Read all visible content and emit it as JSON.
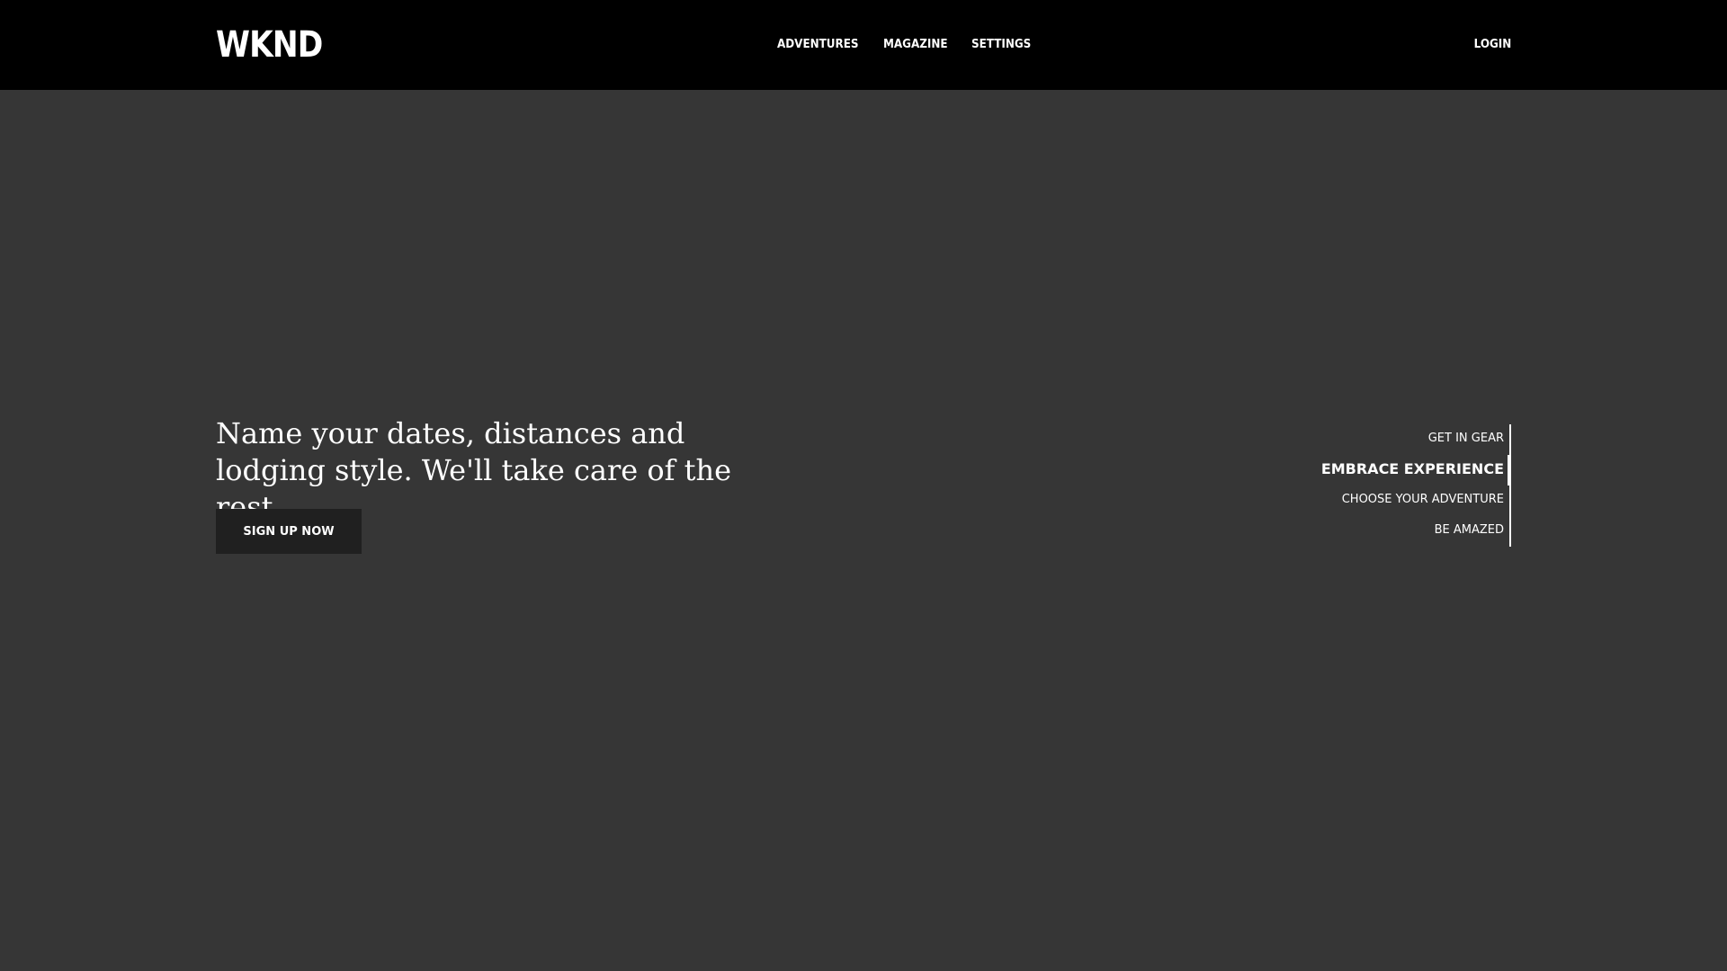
{
  "header": {
    "logo": "WKND",
    "nav": [
      {
        "label": "ADVENTURES"
      },
      {
        "label": "MAGAZINE"
      },
      {
        "label": "SETTINGS"
      }
    ],
    "login_label": "LOGIN"
  },
  "hero": {
    "headline": "Name your dates, distances and lodging style. We'll take care of the rest...",
    "cta_label": "SIGN UP NOW",
    "carousel": {
      "items": [
        {
          "label": "GET IN GEAR"
        },
        {
          "label": "EMBRACE EXPERIENCE"
        },
        {
          "label": "CHOOSE YOUR ADVENTURE"
        },
        {
          "label": "BE AMAZED"
        }
      ],
      "active_index": 1
    }
  },
  "colors": {
    "header_bg": "#000000",
    "hero_bg": "#363636",
    "button_bg": "#202020",
    "text": "#ffffff"
  }
}
